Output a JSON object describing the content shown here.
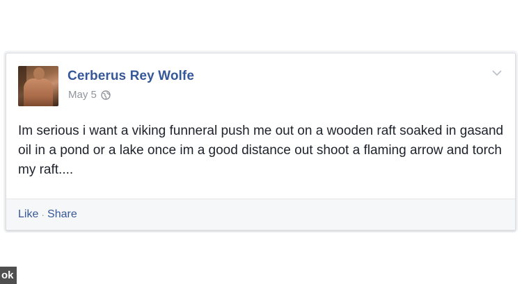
{
  "post": {
    "author": "Cerberus Rey Wolfe",
    "date": "May 5",
    "privacy_icon": "globe-icon",
    "body": "Im serious i want a viking funneral push me out on a wooden raft soaked in gasand oil in a pond or a lake once im a good distance out shoot a flaming arrow and torch my raft....",
    "options_icon": "chevron-down-icon"
  },
  "footer": {
    "like_label": "Like",
    "separator": "·",
    "share_label": "Share"
  },
  "watermark": {
    "text": "ok"
  },
  "colors": {
    "link_blue": "#365899",
    "meta_gray": "#90949c",
    "text": "#1d2129",
    "footer_bg": "#f6f7f9"
  }
}
